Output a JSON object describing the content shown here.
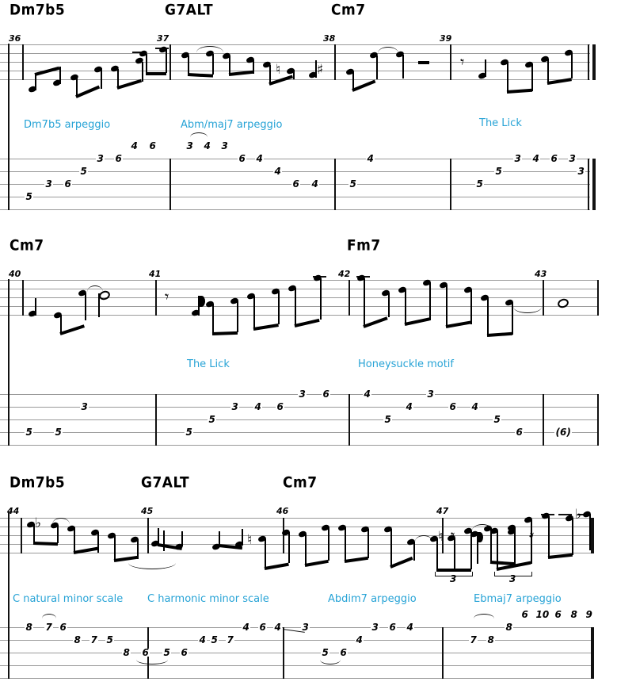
{
  "document": {
    "type": "guitar-solo-transcription",
    "instrument": "guitar",
    "notation": "standard-notation-and-tablature",
    "annotation_color": "#27a3d6"
  },
  "systems": [
    {
      "id": "system-1",
      "measures": [
        "36",
        "37",
        "38",
        "39"
      ],
      "chords": [
        {
          "label": "Dm7b5",
          "measure": "36"
        },
        {
          "label": "G7ALT",
          "measure": "37"
        },
        {
          "label": "Cm7",
          "measure": "38"
        }
      ],
      "annotations": [
        {
          "text": "Dm7b5 arpeggio",
          "measure": "36"
        },
        {
          "text": "Abm/maj7 arpeggio",
          "measure": "37"
        },
        {
          "text": "The Lick",
          "measure": "39"
        }
      ],
      "tab": [
        {
          "measure": "36",
          "notes": [
            {
              "string": 5,
              "fret": "5"
            },
            {
              "string": 4,
              "fret": "3"
            },
            {
              "string": 4,
              "fret": "6"
            },
            {
              "string": 3,
              "fret": "5"
            },
            {
              "string": 2,
              "fret": "3"
            },
            {
              "string": 2,
              "fret": "6"
            },
            {
              "string": 1,
              "fret": "4"
            },
            {
              "string": 1,
              "fret": "6"
            }
          ]
        },
        {
          "measure": "37",
          "notes": [
            {
              "string": 1,
              "fret": "3"
            },
            {
              "string": 1,
              "fret": "4"
            },
            {
              "string": 1,
              "fret": "3"
            },
            {
              "string": 2,
              "fret": "6"
            },
            {
              "string": 2,
              "fret": "4"
            },
            {
              "string": 3,
              "fret": "4"
            },
            {
              "string": 4,
              "fret": "6"
            },
            {
              "string": 4,
              "fret": "4"
            }
          ]
        },
        {
          "measure": "38",
          "notes": [
            {
              "string": 4,
              "fret": "5"
            },
            {
              "string": 2,
              "fret": "4"
            }
          ]
        },
        {
          "measure": "39",
          "notes": [
            {
              "string": 4,
              "fret": "5"
            },
            {
              "string": 3,
              "fret": "5"
            },
            {
              "string": 2,
              "fret": "3"
            },
            {
              "string": 2,
              "fret": "4"
            },
            {
              "string": 2,
              "fret": "6"
            },
            {
              "string": 2,
              "fret": "3"
            },
            {
              "string": 3,
              "fret": "3"
            }
          ]
        }
      ]
    },
    {
      "id": "system-2",
      "measures": [
        "40",
        "41",
        "42",
        "43"
      ],
      "chords": [
        {
          "label": "Cm7",
          "measure": "40"
        },
        {
          "label": "Fm7",
          "measure": "42"
        }
      ],
      "annotations": [
        {
          "text": "The Lick",
          "measure": "41"
        },
        {
          "text": "Honeysuckle motif",
          "measure": "42"
        }
      ],
      "tab": [
        {
          "measure": "40",
          "notes": [
            {
              "string": 4,
              "fret": "5"
            },
            {
              "string": 4,
              "fret": "5"
            },
            {
              "string": 3,
              "fret": "3"
            }
          ]
        },
        {
          "measure": "41",
          "notes": [
            {
              "string": 4,
              "fret": "5"
            },
            {
              "string": 3,
              "fret": "5"
            },
            {
              "string": 2,
              "fret": "3"
            },
            {
              "string": 2,
              "fret": "4"
            },
            {
              "string": 2,
              "fret": "6"
            },
            {
              "string": 1,
              "fret": "3"
            },
            {
              "string": 1,
              "fret": "6"
            }
          ]
        },
        {
          "measure": "42",
          "notes": [
            {
              "string": 1,
              "fret": "4"
            },
            {
              "string": 3,
              "fret": "5"
            },
            {
              "string": 2,
              "fret": "4"
            },
            {
              "string": 1,
              "fret": "3"
            },
            {
              "string": 2,
              "fret": "6"
            },
            {
              "string": 2,
              "fret": "4"
            },
            {
              "string": 3,
              "fret": "5"
            },
            {
              "string": 4,
              "fret": "6"
            }
          ]
        },
        {
          "measure": "43",
          "notes": [
            {
              "string": 4,
              "fret": "(6)"
            }
          ]
        }
      ]
    },
    {
      "id": "system-3",
      "measures": [
        "44",
        "45",
        "46",
        "47"
      ],
      "chords": [
        {
          "label": "Dm7b5",
          "measure": "44"
        },
        {
          "label": "G7ALT",
          "measure": "45"
        },
        {
          "label": "Cm7",
          "measure": "46"
        }
      ],
      "annotations": [
        {
          "text": "C natural minor scale",
          "measure": "44"
        },
        {
          "text": "C harmonic minor scale",
          "measure": "45"
        },
        {
          "text": "Abdim7 arpeggio",
          "measure": "46"
        },
        {
          "text": "Ebmaj7 arpeggio",
          "measure": "47"
        }
      ],
      "tab": [
        {
          "measure": "44",
          "notes": [
            {
              "string": 1,
              "fret": "8"
            },
            {
              "string": 1,
              "fret": "7"
            },
            {
              "string": 1,
              "fret": "6"
            },
            {
              "string": 2,
              "fret": "8"
            },
            {
              "string": 2,
              "fret": "7"
            },
            {
              "string": 2,
              "fret": "5"
            },
            {
              "string": 3,
              "fret": "8"
            },
            {
              "string": 3,
              "fret": "6"
            }
          ]
        },
        {
          "measure": "45",
          "notes": [
            {
              "string": 3,
              "fret": "5"
            },
            {
              "string": 3,
              "fret": "6"
            },
            {
              "string": 2,
              "fret": "4"
            },
            {
              "string": 2,
              "fret": "5"
            },
            {
              "string": 2,
              "fret": "7"
            },
            {
              "string": 1,
              "fret": "4"
            },
            {
              "string": 1,
              "fret": "6"
            },
            {
              "string": 1,
              "fret": "4"
            }
          ]
        },
        {
          "measure": "46",
          "notes": [
            {
              "string": 1,
              "fret": "3"
            },
            {
              "string": 3,
              "fret": "5"
            },
            {
              "string": 3,
              "fret": "6"
            },
            {
              "string": 2,
              "fret": "4"
            },
            {
              "string": 1,
              "fret": "3"
            },
            {
              "string": 1,
              "fret": "6"
            },
            {
              "string": 1,
              "fret": "4"
            }
          ]
        },
        {
          "measure": "47",
          "notes": [
            {
              "string": 2,
              "fret": "7"
            },
            {
              "string": 2,
              "fret": "8"
            },
            {
              "string": 1,
              "fret": "8"
            },
            {
              "string": 0,
              "fret": "6"
            },
            {
              "string": 0,
              "fret": "10"
            },
            {
              "string": 0,
              "fret": "6"
            },
            {
              "string": 0,
              "fret": "8"
            },
            {
              "string": 0,
              "fret": "9"
            }
          ]
        }
      ]
    }
  ]
}
